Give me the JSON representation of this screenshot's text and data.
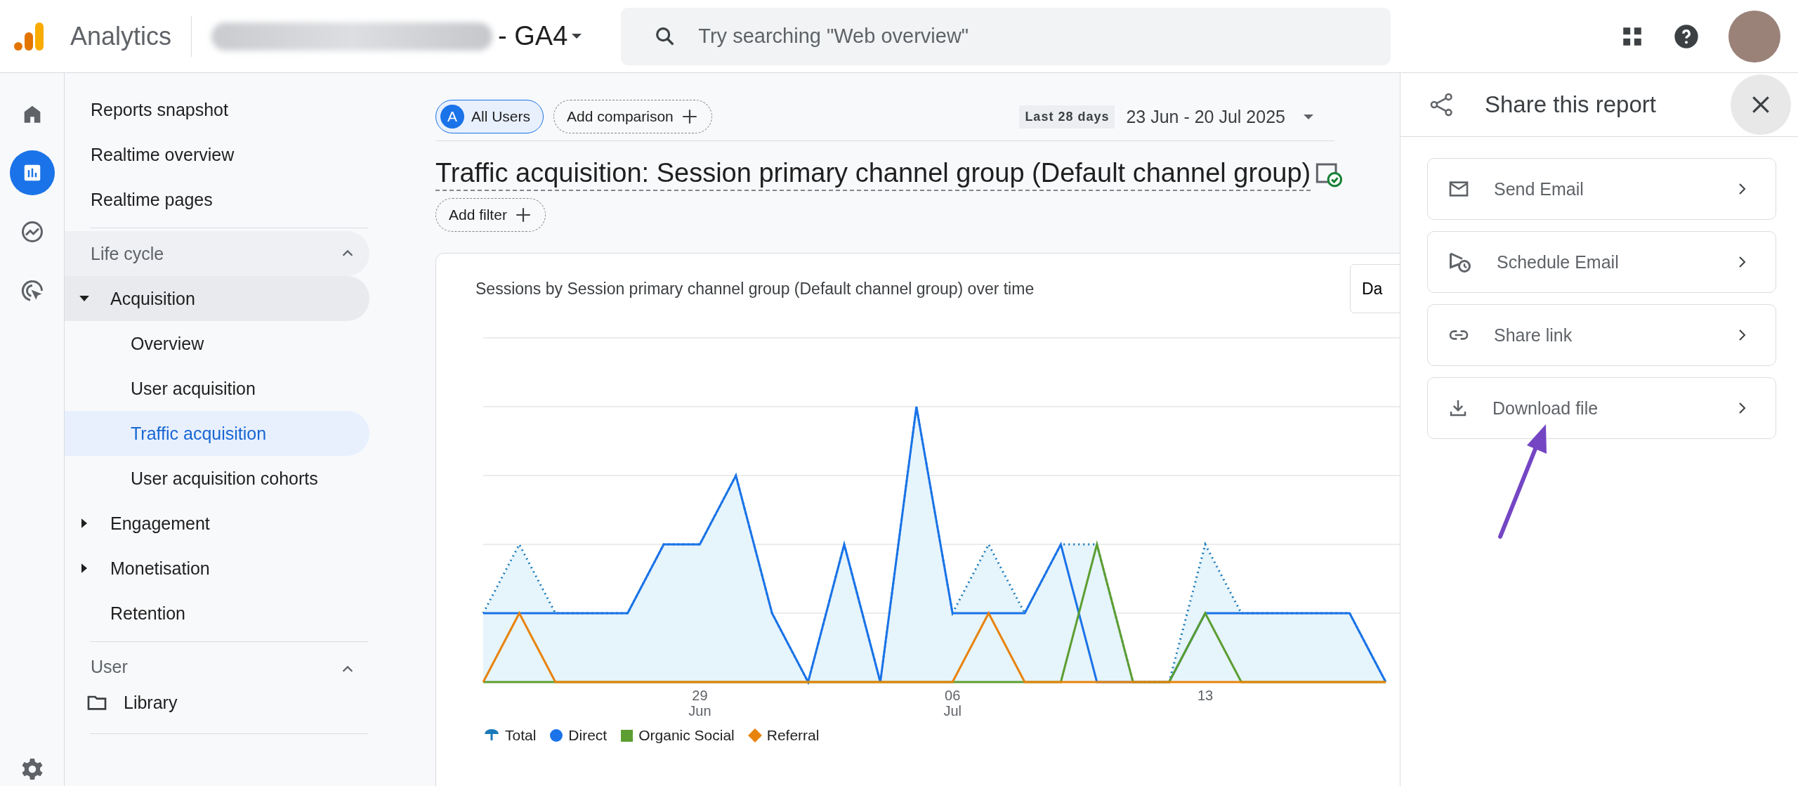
{
  "topbar": {
    "app_name": "Analytics",
    "property_suffix": "- GA4",
    "search": {
      "placeholder": "Try searching \"Web overview\""
    }
  },
  "rail": [
    {
      "selected": false
    },
    {
      "selected": true
    },
    {
      "selected": false
    },
    {
      "selected": false
    }
  ],
  "nav": {
    "top_items": [
      {
        "label": "Reports snapshot",
        "selected": false
      },
      {
        "label": "Realtime overview",
        "selected": false
      },
      {
        "label": "Realtime pages",
        "selected": false
      }
    ],
    "sections": [
      {
        "title": "Life cycle",
        "expanded": true,
        "items": [
          {
            "label": "Acquisition",
            "kind": "folder",
            "expanded": true,
            "children": [
              {
                "label": "Overview",
                "selected": false
              },
              {
                "label": "User acquisition",
                "selected": false
              },
              {
                "label": "Traffic acquisition",
                "selected": true
              },
              {
                "label": "User acquisition cohorts",
                "selected": false
              }
            ]
          },
          {
            "label": "Engagement",
            "kind": "folder",
            "expanded": false
          },
          {
            "label": "Monetisation",
            "kind": "folder",
            "expanded": false
          },
          {
            "label": "Retention",
            "kind": "page"
          }
        ]
      },
      {
        "title": "User",
        "expanded": true
      }
    ],
    "library": {
      "label": "Library"
    }
  },
  "main": {
    "segment": {
      "badge": "A",
      "label": "All Users"
    },
    "add_comparison": "Add comparison",
    "date_preset": "Last 28 days",
    "date_range": "23 Jun - 20 Jul 2025",
    "title": "Traffic acquisition: Session primary channel group (Default channel group)",
    "add_filter": "Add filter",
    "chart": {
      "title": "Sessions by Session primary channel group (Default channel group) over time",
      "button": "Da",
      "x_labels": [
        {
          "day": "29",
          "month": "Jun"
        },
        {
          "day": "06",
          "month": "Jul"
        },
        {
          "day": "13"
        }
      ],
      "legend": [
        {
          "label": "Total",
          "kind": "area",
          "color": "#1a7bb9"
        },
        {
          "label": "Direct",
          "kind": "circle",
          "color": "#1a73e8"
        },
        {
          "label": "Organic Social",
          "kind": "square",
          "color": "#5c9e31"
        },
        {
          "label": "Referral",
          "kind": "diamond",
          "color": "#e8830c"
        }
      ]
    }
  },
  "share_panel": {
    "title": "Share this report",
    "items": [
      {
        "label": "Send Email"
      },
      {
        "label": "Schedule Email"
      },
      {
        "label": "Share link"
      },
      {
        "label": "Download file"
      }
    ]
  }
}
